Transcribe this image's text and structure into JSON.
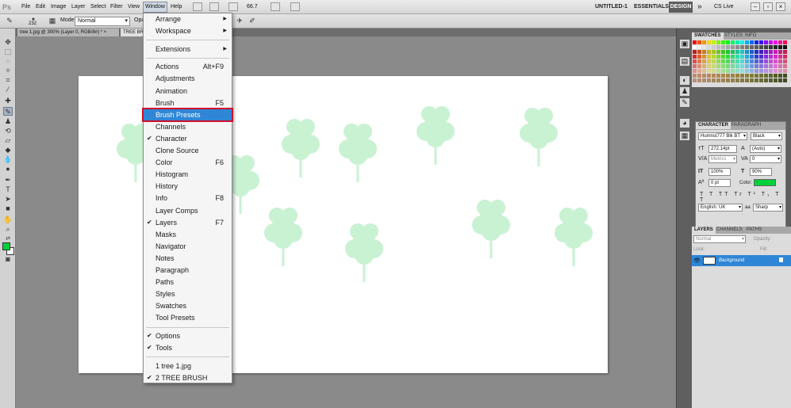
{
  "app": {
    "logo": "Ps",
    "menus": [
      "File",
      "Edit",
      "Image",
      "Layer",
      "Select",
      "Filter",
      "View",
      "Window",
      "Help"
    ],
    "zoom": "66.7",
    "workspaces": [
      "UNTITLED-1",
      "ESSENTIALS",
      "DESIGN"
    ],
    "more": "»",
    "cslive": "CS Live"
  },
  "options": {
    "brush_size": "232",
    "mode_label": "Mode:",
    "mode_value": "Normal",
    "opacity_label": "Opa"
  },
  "doc_tabs": [
    "tree 1.jpg @ 300% (Layer 0, RGB/8#) * ×",
    "TREE BRU"
  ],
  "window_menu": {
    "groups": [
      [
        {
          "label": "Arrange",
          "submenu": true
        },
        {
          "label": "Workspace",
          "submenu": true
        }
      ],
      [
        {
          "label": "Extensions",
          "submenu": true
        }
      ],
      [
        {
          "label": "Actions",
          "shortcut": "Alt+F9"
        },
        {
          "label": "Adjustments"
        },
        {
          "label": "Animation"
        },
        {
          "label": "Brush",
          "shortcut": "F5"
        },
        {
          "label": "Brush Presets",
          "highlighted": true
        },
        {
          "label": "Channels"
        },
        {
          "label": "Character",
          "checked": true
        },
        {
          "label": "Clone Source"
        },
        {
          "label": "Color",
          "shortcut": "F6"
        },
        {
          "label": "Histogram"
        },
        {
          "label": "History"
        },
        {
          "label": "Info",
          "shortcut": "F8"
        },
        {
          "label": "Layer Comps"
        },
        {
          "label": "Layers",
          "shortcut": "F7",
          "checked": true
        },
        {
          "label": "Masks"
        },
        {
          "label": "Navigator"
        },
        {
          "label": "Notes"
        },
        {
          "label": "Paragraph"
        },
        {
          "label": "Paths"
        },
        {
          "label": "Styles"
        },
        {
          "label": "Swatches"
        },
        {
          "label": "Tool Presets"
        }
      ],
      [
        {
          "label": "Options",
          "checked": true
        },
        {
          "label": "Tools",
          "checked": true
        }
      ],
      [
        {
          "label": "1 tree 1.jpg"
        },
        {
          "label": "2 TREE BRUSH",
          "checked": true
        }
      ]
    ],
    "check_glyph": "✔",
    "submenu_glyph": "▶"
  },
  "swatch_panel": {
    "tabs": [
      "SWATCHES",
      "STYLES",
      "INFO"
    ]
  },
  "character_panel": {
    "tabs": [
      "CHARACTER",
      "PARAGRAPH"
    ],
    "font_family": "Humnst777 Blk BT",
    "font_style": "Black",
    "font_size": "272.14pt",
    "leading": "(Auto)",
    "kerning": "Metrics",
    "tracking": "0",
    "vertical_scale": "100%",
    "horizontal_scale": "90%",
    "baseline_shift": "0 pt",
    "color_label": "Color:",
    "language": "English: UK",
    "antialias": "Sharp",
    "style_buttons": "T T TT Tr T¹ T₁ T T"
  },
  "layers_panel": {
    "tabs": [
      "LAYERS",
      "CHANNELS",
      "PATHS"
    ],
    "blend_mode": "Normal",
    "opacity_label": "Opacity:",
    "fill_label": "Fill:",
    "lock_label": "Lock:",
    "layer_name": "Background"
  },
  "colors": {
    "foreground": "#00d13a",
    "background": "#ffffff",
    "tree": "#c9f2d2",
    "highlight": "#2f86d6",
    "highlight_outline": "#d0102a"
  }
}
